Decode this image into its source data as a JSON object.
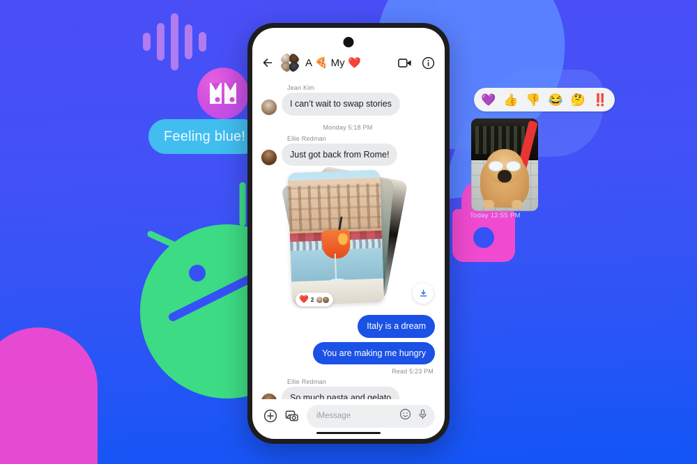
{
  "background": {
    "colors": {
      "top": "#4a4ef7",
      "bottom": "#1255f6",
      "bubble": "#5b86ff",
      "accent_pink": "#f04ad0",
      "accent_purple": "#b07cf0",
      "android_green": "#3ddc84"
    },
    "decor": {
      "waveform_name": "voice-waveform",
      "messages_logo_name": "google-messages-logo",
      "android_name": "android-robot-head",
      "lock_name": "padlock-shape"
    }
  },
  "floating": {
    "feeling_bubble": "Feeling blue!",
    "reaction_bar": [
      "💜",
      "👍",
      "👎",
      "😂",
      "🤔",
      "‼️"
    ],
    "dog_photo_timestamp": "Today  12:55 PM"
  },
  "phone": {
    "header": {
      "back_label": "←",
      "chat_title": "A 🍕 My ❤️",
      "video_call_label": "video-call",
      "info_label": "info"
    },
    "thread": {
      "messages": [
        {
          "type": "incoming",
          "sender": "Jean Kim",
          "text": "I can’t wait to swap stories"
        },
        {
          "type": "daystamp",
          "text": "Monday 5:18 PM"
        },
        {
          "type": "incoming",
          "sender": "Ellie Redman",
          "text": "Just got back from Rome!"
        },
        {
          "type": "photo_stack",
          "reaction_emoji": "❤️",
          "reaction_count": "2"
        },
        {
          "type": "outgoing",
          "text": "Italy is a dream"
        },
        {
          "type": "outgoing",
          "text": "You are making me hungry"
        },
        {
          "type": "readstamp",
          "text": "Read  5:23 PM"
        },
        {
          "type": "incoming",
          "sender": "Ellie Redman",
          "text": "So much pasta and gelato"
        }
      ]
    },
    "composer": {
      "plus_label": "add-attachment",
      "gallery_label": "gallery",
      "placeholder": "iMessage",
      "emoji_label": "emoji",
      "mic_label": "microphone"
    }
  }
}
